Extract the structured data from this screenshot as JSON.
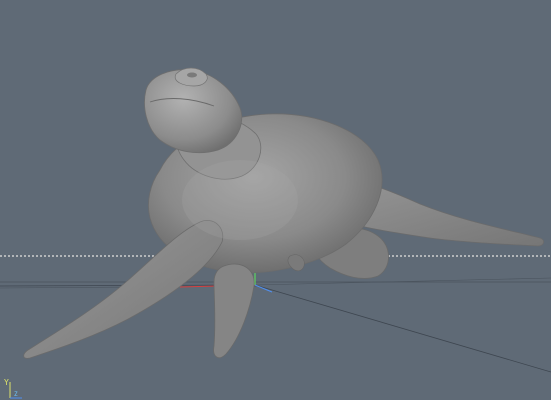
{
  "viewport": {
    "background_color": "#5f6a76",
    "model": "sea-turtle",
    "shading": "gray-solid",
    "grid_color": "#3e4650",
    "horizon_color": "#c9c9c9",
    "axis_colors": {
      "x": "#d64040",
      "y": "#5ed65e",
      "z": "#4f8ff0"
    }
  },
  "axis_indicator": {
    "y_label": "Y",
    "z_label": "Z"
  }
}
